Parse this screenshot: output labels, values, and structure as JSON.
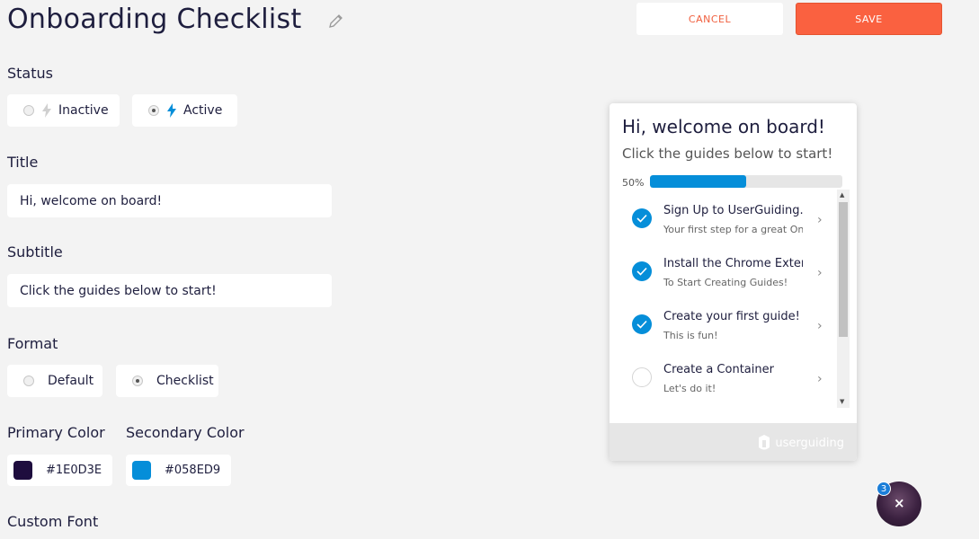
{
  "header": {
    "title": "Onboarding Checklist",
    "cancel_label": "CANCEL",
    "save_label": "SAVE"
  },
  "status": {
    "label": "Status",
    "options": [
      {
        "label": "Inactive",
        "selected": false
      },
      {
        "label": "Active",
        "selected": true
      }
    ]
  },
  "title_field": {
    "label": "Title",
    "value": "Hi, welcome on board!"
  },
  "subtitle_field": {
    "label": "Subtitle",
    "value": "Click the guides below to start!"
  },
  "format": {
    "label": "Format",
    "options": [
      {
        "label": "Default",
        "selected": false
      },
      {
        "label": "Checklist",
        "selected": true
      }
    ]
  },
  "colors": {
    "primary_label": "Primary Color",
    "primary_value": "#1E0D3E",
    "secondary_label": "Secondary Color",
    "secondary_value": "#058ED9"
  },
  "custom_font": {
    "label": "Custom Font"
  },
  "preview": {
    "title": "Hi, welcome on board!",
    "subtitle": "Click the guides below to start!",
    "progress_text": "50%",
    "progress_value": 0.5,
    "items": [
      {
        "title": "Sign Up to UserGuiding.com",
        "desc": "Your first step for a great Onboarding",
        "done": true
      },
      {
        "title": "Install the Chrome Extension",
        "desc": "To Start Creating Guides!",
        "done": true
      },
      {
        "title": "Create your first guide!",
        "desc": "This is fun!",
        "done": true
      },
      {
        "title": "Create a Container",
        "desc": "Let's do it!",
        "done": false
      }
    ],
    "footer_logo": "userguiding"
  },
  "launcher": {
    "badge_count": "3",
    "close_glyph": "×"
  }
}
